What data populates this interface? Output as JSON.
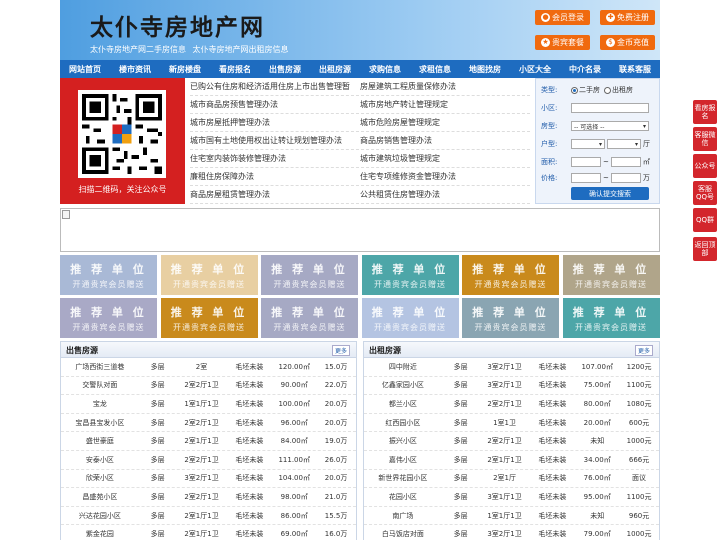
{
  "header": {
    "title": "太仆寺房地产网",
    "subtitle": "太仆寺房地产网二手房信息  太仆寺房地产网出租房信息",
    "buttons": [
      "会员登录",
      "免费注册",
      "贵宾套餐",
      "金币充值"
    ]
  },
  "nav": [
    "网站首页",
    "楼市资讯",
    "新房楼盘",
    "看房报名",
    "出售房源",
    "出租房源",
    "求购信息",
    "求租信息",
    "地图找房",
    "小区大全",
    "中介名录",
    "联系客服"
  ],
  "qr": {
    "caption": "扫描二维码，关注公众号"
  },
  "links": [
    [
      "已购公有住房和经济适用住房上市出售管理暂",
      "房屋建筑工程质量保修办法"
    ],
    [
      "城市商品房预售管理办法",
      "城市房地产转让管理规定"
    ],
    [
      "城市房屋抵押管理办法",
      "城市危险房屋管理规定"
    ],
    [
      "城市国有土地使用权出让转让规划管理办法",
      "商品房销售管理办法"
    ],
    [
      "住宅室内装饰装修管理办法",
      "城市建筑垃圾管理规定"
    ],
    [
      "廉租住房保障办法",
      "住宅专项维修资金管理办法"
    ],
    [
      "商品房屋租赁管理办法",
      "公共租赁住房管理办法"
    ]
  ],
  "search": {
    "type_label": "类型:",
    "type_options": [
      "二手房",
      "出租房"
    ],
    "community_label": "小区:",
    "housetype_label": "房型:",
    "housetype_value": "-- 可选择 --",
    "layout_label": "户型:",
    "layout_unit": "厅",
    "area_label": "面积:",
    "area_sep": "~",
    "area_unit": "㎡",
    "price_label": "价格:",
    "price_sep": "~",
    "price_unit": "万",
    "submit": "确认提交搜索"
  },
  "recommend": {
    "line1": "推 荐 单 位",
    "line2": "开通贵宾会员赠送",
    "colors": [
      "#a9b9d6",
      "#e8cfa2",
      "#a6a9c4",
      "#4da6a8",
      "#c98a1c",
      "#b0a58a",
      "#a9a9c6",
      "#c98a1c",
      "#a6a9c4",
      "#b4c4e2",
      "#8aa5b2",
      "#4da6a8"
    ]
  },
  "sale": {
    "title": "出售房源",
    "more": "更多",
    "rows": [
      [
        "广场西街三道巷",
        "多层",
        "2室",
        "毛坯未装",
        "120.00㎡",
        "15.0万"
      ],
      [
        "交警队对面",
        "多层",
        "2室2厅1卫",
        "毛坯未装",
        "90.00㎡",
        "22.0万"
      ],
      [
        "宝龙",
        "多层",
        "1室1厅1卫",
        "毛坯未装",
        "100.00㎡",
        "20.0万"
      ],
      [
        "宝昌县宝发小区",
        "多层",
        "2室2厅1卫",
        "毛坯未装",
        "96.00㎡",
        "20.0万"
      ],
      [
        "盛世豪庭",
        "多层",
        "2室1厅1卫",
        "毛坯未装",
        "84.00㎡",
        "19.0万"
      ],
      [
        "安泰小区",
        "多层",
        "2室2厅1卫",
        "毛坯未装",
        "111.00㎡",
        "26.0万"
      ],
      [
        "欣荣小区",
        "多层",
        "3室2厅1卫",
        "毛坯未装",
        "104.00㎡",
        "20.0万"
      ],
      [
        "昌盛苑小区",
        "多层",
        "2室2厅1卫",
        "毛坯未装",
        "98.00㎡",
        "21.0万"
      ],
      [
        "兴达花园小区",
        "多层",
        "2室1厅1卫",
        "毛坯未装",
        "86.00㎡",
        "15.5万"
      ],
      [
        "紫金花园",
        "多层",
        "2室1厅1卫",
        "毛坯未装",
        "69.00㎡",
        "16.0万"
      ]
    ]
  },
  "rent": {
    "title": "出租房源",
    "more": "更多",
    "rows": [
      [
        "四中附近",
        "多层",
        "3室2厅1卫",
        "毛坯未装",
        "107.00㎡",
        "1200元"
      ],
      [
        "亿鑫家园小区",
        "多层",
        "3室2厅1卫",
        "毛坯未装",
        "75.00㎡",
        "1100元"
      ],
      [
        "都兰小区",
        "多层",
        "2室2厅1卫",
        "毛坯未装",
        "80.00㎡",
        "1080元"
      ],
      [
        "红西园小区",
        "多层",
        "1室1卫",
        "毛坯未装",
        "20.00㎡",
        "600元"
      ],
      [
        "振兴小区",
        "多层",
        "2室2厅1卫",
        "毛坯未装",
        "未知",
        "1000元"
      ],
      [
        "嘉伟小区",
        "多层",
        "2室1厅1卫",
        "毛坯未装",
        "34.00㎡",
        "666元"
      ],
      [
        "新世界花园小区",
        "多层",
        "2室1厅",
        "毛坯未装",
        "76.00㎡",
        "面议"
      ],
      [
        "花园小区",
        "多层",
        "3室1厅1卫",
        "毛坯未装",
        "95.00㎡",
        "1100元"
      ],
      [
        "南广场",
        "多层",
        "1室1厅1卫",
        "毛坯未装",
        "未知",
        "960元"
      ],
      [
        "白马饭店对面",
        "多层",
        "3室2厅1卫",
        "毛坯未装",
        "79.00㎡",
        "1000元"
      ]
    ]
  },
  "sidebar": [
    "看房报名",
    "客服微信",
    "公众号",
    "客服QQ号",
    "QQ群",
    "返回顶部"
  ]
}
